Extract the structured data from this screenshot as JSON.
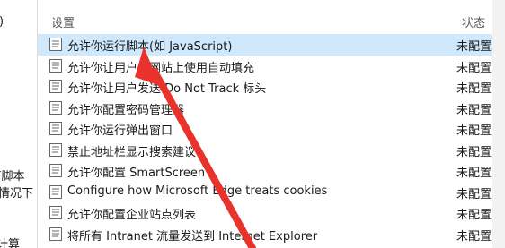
{
  "left_panel": {
    "lines": [
      ")",
      "F脚本",
      "情况下",
      "计算"
    ]
  },
  "header": {
    "setting_label": "设置",
    "status_label": "状态"
  },
  "rows": [
    {
      "name": "允许你运行脚本(如 JavaScript)",
      "state": "未配置",
      "selected": true
    },
    {
      "name": "允许你让用户在网站上使用自动填充",
      "state": "未配置",
      "selected": false
    },
    {
      "name": "允许你让用户发送 Do Not Track 标头",
      "state": "未配置",
      "selected": false
    },
    {
      "name": "允许你配置密码管理器",
      "state": "未配置",
      "selected": false
    },
    {
      "name": "允许你运行弹出窗口",
      "state": "未配置",
      "selected": false
    },
    {
      "name": "禁止地址栏显示搜索建议",
      "state": "未配置",
      "selected": false
    },
    {
      "name": "允许你配置 SmartScreen",
      "state": "未配置",
      "selected": false
    },
    {
      "name": "Configure how Microsoft Edge treats cookies",
      "state": "未配置",
      "selected": false
    },
    {
      "name": "允许你配置企业站点列表",
      "state": "未配置",
      "selected": false
    },
    {
      "name": "将所有 Intranet 流量发送到 Internet Explorer",
      "state": "未配置",
      "selected": false
    }
  ],
  "icons": {
    "policy": "policy-setting-icon",
    "arrow": "red-arrow-annotation"
  },
  "colors": {
    "selected_row": "#cfe8fc",
    "arrow": "#e8322b"
  }
}
